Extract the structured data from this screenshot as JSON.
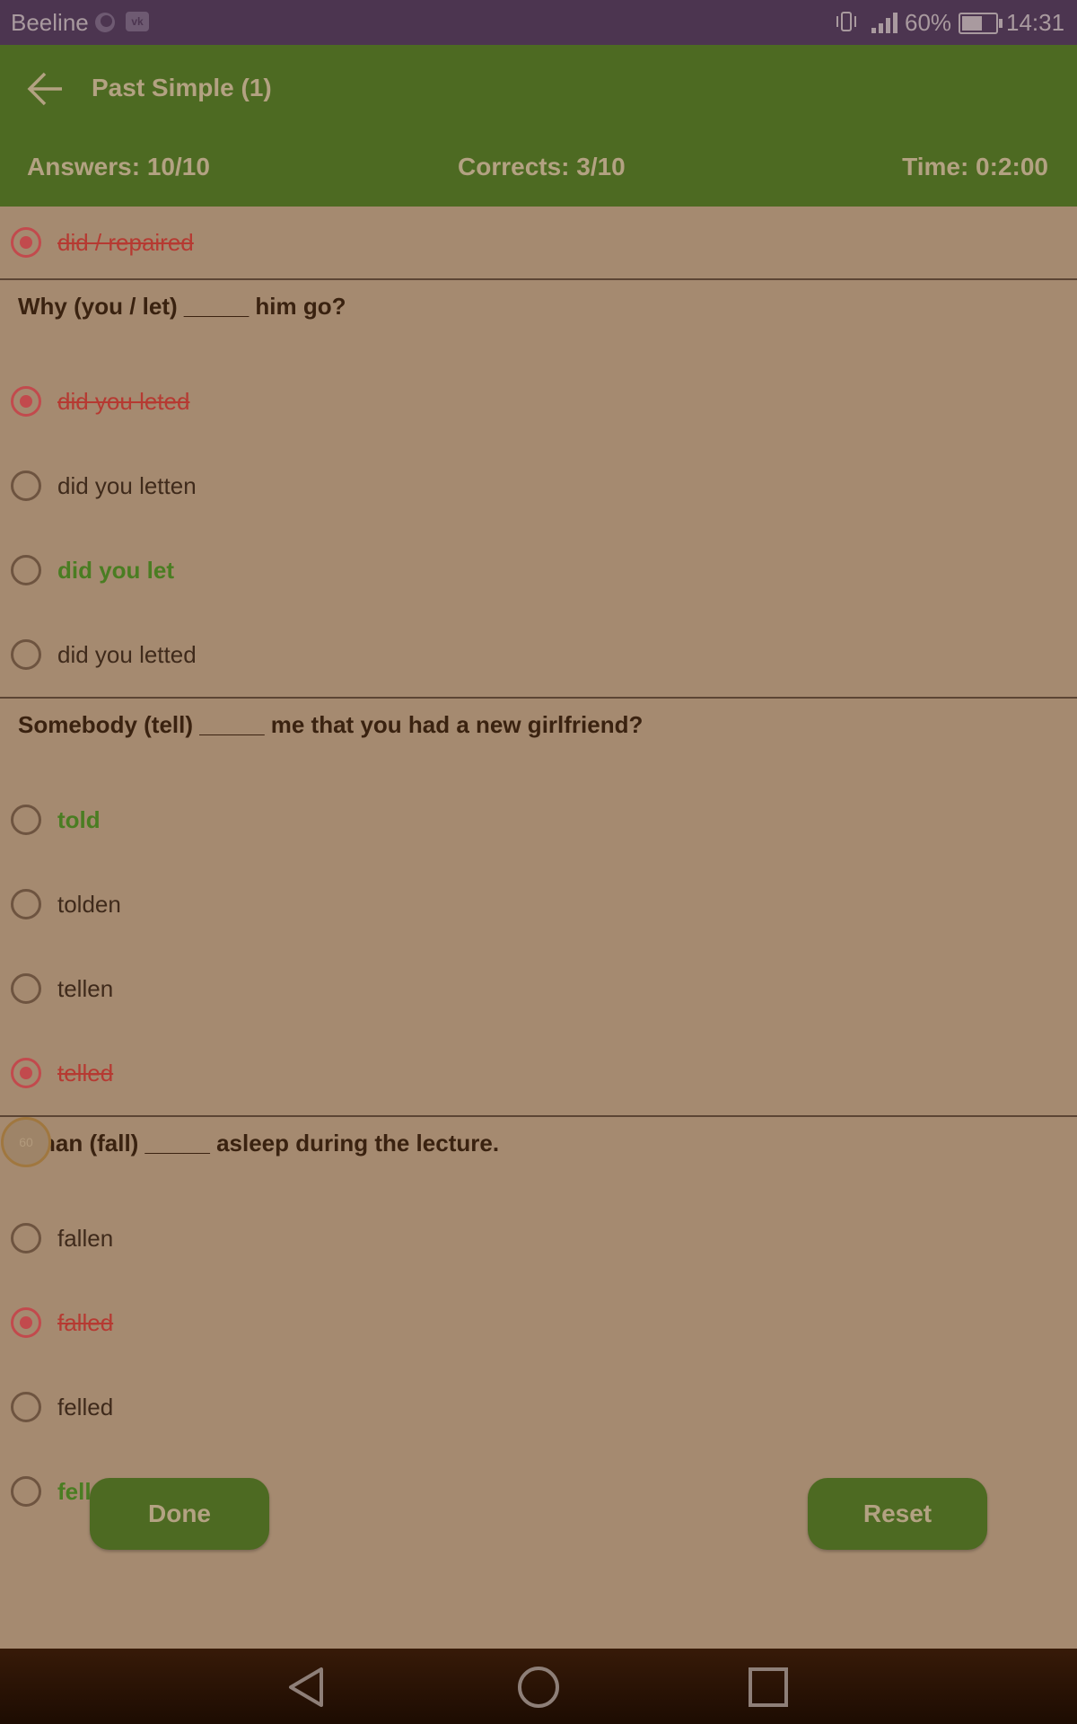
{
  "status_bar": {
    "carrier": "Beeline",
    "battery_percent": "60%",
    "time": "14:31"
  },
  "header": {
    "title": "Past Simple (1)",
    "answers": "Answers: 10/10",
    "corrects": "Corrects: 3/10",
    "time": "Time: 0:2:00"
  },
  "prev_option": {
    "text": "did / repaired",
    "state": "wrong",
    "selected": true
  },
  "questions": [
    {
      "text": "Why (you / let) _____ him go?",
      "options": [
        {
          "text": "did you leted",
          "state": "wrong",
          "selected": true
        },
        {
          "text": "did you letten",
          "state": "neutral",
          "selected": false
        },
        {
          "text": "did you let",
          "state": "right",
          "selected": false
        },
        {
          "text": "did you letted",
          "state": "neutral",
          "selected": false
        }
      ]
    },
    {
      "text": "Somebody (tell) _____ me that you had a new girlfriend?",
      "options": [
        {
          "text": "told",
          "state": "right",
          "selected": false
        },
        {
          "text": "tolden",
          "state": "neutral",
          "selected": false
        },
        {
          "text": "tellen",
          "state": "neutral",
          "selected": false
        },
        {
          "text": "telled",
          "state": "wrong",
          "selected": true
        }
      ]
    },
    {
      "text": "Ethan (fall) _____ asleep during the lecture.",
      "options": [
        {
          "text": "fallen",
          "state": "neutral",
          "selected": false
        },
        {
          "text": "falled",
          "state": "wrong",
          "selected": true
        },
        {
          "text": "felled",
          "state": "neutral",
          "selected": false
        },
        {
          "text": "fell",
          "state": "right",
          "selected": false
        }
      ]
    }
  ],
  "floating_badge": "60",
  "buttons": {
    "done": "Done",
    "reset": "Reset"
  },
  "colors": {
    "wrong": "#b63a32",
    "right": "#4a7d22",
    "header": "#4d6a22"
  },
  "icons": [
    "back-arrow-icon",
    "nav-back-icon",
    "nav-home-icon",
    "nav-recent-icon"
  ]
}
